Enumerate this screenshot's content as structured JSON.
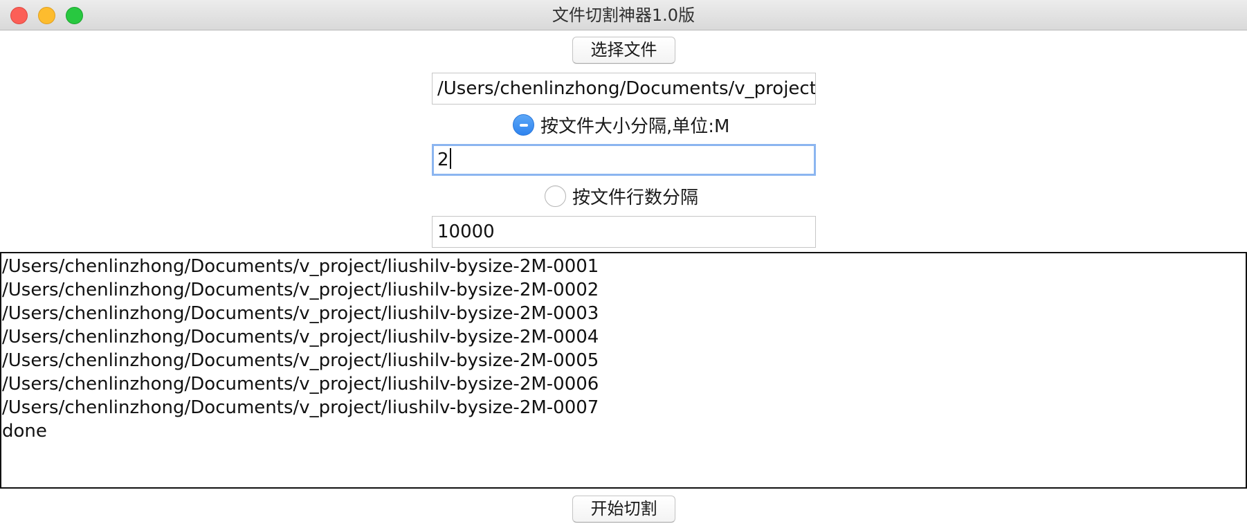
{
  "window": {
    "title": "文件切割神器1.0版"
  },
  "controls": {
    "choose_file_label": "选择文件",
    "file_path": "/Users/chenlinzhong/Documents/v_project",
    "by_size": {
      "label": "按文件大小分隔,单位:M",
      "selected": true,
      "value": "2"
    },
    "by_lines": {
      "label": "按文件行数分隔",
      "selected": false,
      "value": "10000"
    },
    "start_label": "开始切割"
  },
  "log": {
    "lines": [
      "/Users/chenlinzhong/Documents/v_project/liushilv-bysize-2M-0001",
      "/Users/chenlinzhong/Documents/v_project/liushilv-bysize-2M-0002",
      "/Users/chenlinzhong/Documents/v_project/liushilv-bysize-2M-0003",
      "/Users/chenlinzhong/Documents/v_project/liushilv-bysize-2M-0004",
      "/Users/chenlinzhong/Documents/v_project/liushilv-bysize-2M-0005",
      "/Users/chenlinzhong/Documents/v_project/liushilv-bysize-2M-0006",
      "/Users/chenlinzhong/Documents/v_project/liushilv-bysize-2M-0007",
      "done"
    ]
  },
  "colors": {
    "accent": "#2f84ef",
    "focus_ring": "#8bb5f0",
    "close": "#fc5f57",
    "minimize": "#fdbc2e",
    "maximize": "#28c840"
  },
  "icons": {
    "close": "close-icon",
    "minimize": "minimize-icon",
    "maximize": "maximize-icon",
    "radio_selected": "radio-selected-icon",
    "radio_unselected": "radio-unselected-icon"
  }
}
